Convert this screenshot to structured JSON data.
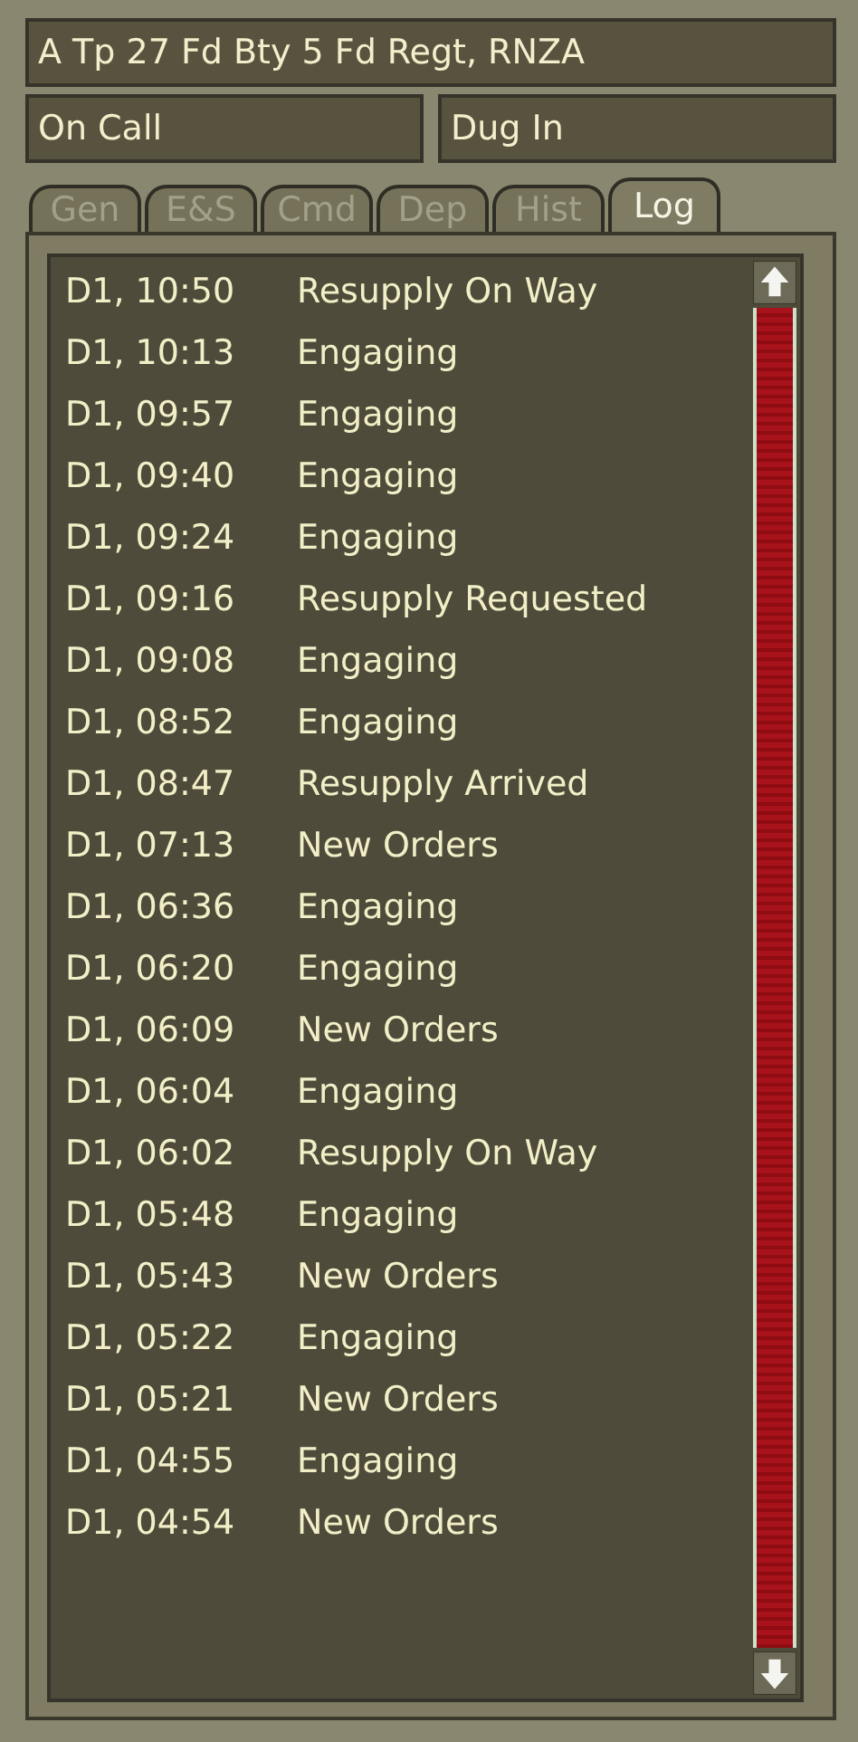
{
  "unit": {
    "title": "A Tp 27 Fd Bty 5 Fd Regt, RNZA",
    "status": "On Call",
    "posture": "Dug In"
  },
  "tabs": [
    {
      "label": "Gen",
      "selected": false
    },
    {
      "label": "E&S",
      "selected": false
    },
    {
      "label": "Cmd",
      "selected": false
    },
    {
      "label": "Dep",
      "selected": false
    },
    {
      "label": "Hist",
      "selected": false
    },
    {
      "label": "Log",
      "selected": true
    }
  ],
  "log": [
    {
      "time": "D1, 10:50",
      "event": "Resupply On Way"
    },
    {
      "time": "D1, 10:13",
      "event": "Engaging"
    },
    {
      "time": "D1, 09:57",
      "event": "Engaging"
    },
    {
      "time": "D1, 09:40",
      "event": "Engaging"
    },
    {
      "time": "D1, 09:24",
      "event": "Engaging"
    },
    {
      "time": "D1, 09:16",
      "event": "Resupply Requested"
    },
    {
      "time": "D1, 09:08",
      "event": "Engaging"
    },
    {
      "time": "D1, 08:52",
      "event": "Engaging"
    },
    {
      "time": "D1, 08:47",
      "event": "Resupply Arrived"
    },
    {
      "time": "D1, 07:13",
      "event": "New Orders"
    },
    {
      "time": "D1, 06:36",
      "event": "Engaging"
    },
    {
      "time": "D1, 06:20",
      "event": "Engaging"
    },
    {
      "time": "D1, 06:09",
      "event": "New Orders"
    },
    {
      "time": "D1, 06:04",
      "event": "Engaging"
    },
    {
      "time": "D1, 06:02",
      "event": "Resupply On Way"
    },
    {
      "time": "D1, 05:48",
      "event": "Engaging"
    },
    {
      "time": "D1, 05:43",
      "event": "New Orders"
    },
    {
      "time": "D1, 05:22",
      "event": "Engaging"
    },
    {
      "time": "D1, 05:21",
      "event": "New Orders"
    },
    {
      "time": "D1, 04:55",
      "event": "Engaging"
    },
    {
      "time": "D1, 04:54",
      "event": "New Orders"
    }
  ]
}
